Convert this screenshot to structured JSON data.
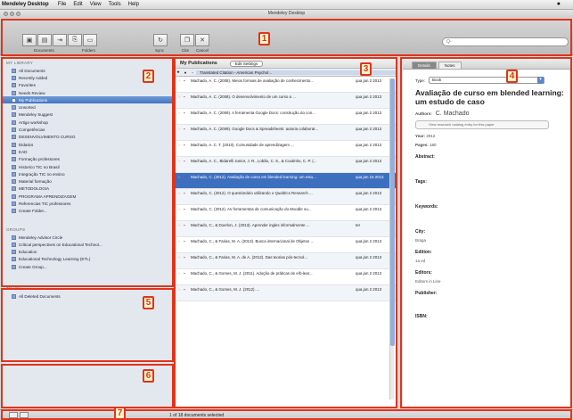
{
  "menubar": {
    "app": "Mendeley Desktop",
    "items": [
      "File",
      "Edit",
      "View",
      "Tools",
      "Help"
    ]
  },
  "window": {
    "title": "Mendeley Desktop"
  },
  "toolbar": {
    "groups": [
      {
        "label": "Documents"
      },
      {
        "label": "Folders"
      },
      {
        "label": "Sync"
      },
      {
        "label": "Cite"
      },
      {
        "label": "Cancel"
      }
    ],
    "search_placeholder": "Q-"
  },
  "callouts": [
    "1",
    "2",
    "3",
    "4",
    "5",
    "6",
    "7"
  ],
  "sidebar": {
    "library_title": "MY LIBRARY",
    "library_items": [
      "All Documents",
      "Recently Added",
      "Favorites",
      "Needs Review",
      "My Publications",
      "Unsorted",
      "Mendeley Suggest",
      "Artigo workshop",
      "Competências",
      "DESENVOLVIMENTO CURSO",
      "Didatics",
      "EAD",
      "Formação professores",
      "Historico TIC no Brasil",
      "Integração TIC no ensino",
      "Material formação",
      "METODOLOGIA",
      "PROGRAMA APRENDIZAGEM",
      "Referencias TIC professores",
      "Create Folder..."
    ],
    "selected_index": 4,
    "groups_title": "GROUPS",
    "groups_items": [
      "Mendeley Advisor Circle",
      "Critical perspectives on Educational Technol...",
      "Education",
      "Educational Technology Learning (ETL)",
      "Create Group..."
    ],
    "trash_title": "TRASH",
    "trash_items": [
      "All Deleted Documents"
    ]
  },
  "middle": {
    "title": "My Publications",
    "edit_settings": "Edit Settings",
    "column_title": "Translated Citation - American Psychol...",
    "rows": [
      {
        "text": "Machado, A. C. (2008). Meios formais de avaliação de conhecimento...",
        "date": "qua jan 2 2013"
      },
      {
        "text": "Machado, A. C. (2008). O desenvolvimento de um curso a ...",
        "date": "qua jan 2 2013"
      },
      {
        "text": "Machado, A. C. (2009). A ferramenta Google Docs: construção do con...",
        "date": "qua jan 2 2013"
      },
      {
        "text": "Machado, A. C. (2009). Google Docs & Spreadsheets: autoria colaborat...",
        "date": "qua jan 2 2013"
      },
      {
        "text": "Machado, A. C. T. (2010). Comunidade de aprendizagem ...",
        "date": "qua jan 2 2013"
      },
      {
        "text": "Machado, A. C., Bidarelli Junior, J. R., Lobão, C. S., & Coutinho, C. P. (...",
        "date": "qua jan 2 2013"
      },
      {
        "text": "Machado, C. (2012). Avaliação de curso em blended learning: um estu...",
        "date": "qua jan 16 2013"
      },
      {
        "text": "Machado, C. (2012). O questionário utilizando o Qualtrics Research ...",
        "date": "qua jan 2 2013"
      },
      {
        "text": "Machado, C. (2012). As ferramentas de comunicação do Moodle ou...",
        "date": "qua jan 2 2013"
      },
      {
        "text": "Machado, C., & Doerlon, J. (2013). Aprender ingles informalmente ...",
        "date": "ter"
      },
      {
        "text": "Machado, C., & Farias, M. A. (2013). Busca internacional de Objetos ...",
        "date": "qua jan 2 2013"
      },
      {
        "text": "Machado, C., & Farias, M. A. de A. (2012). Das teorias pós-tecnol...",
        "date": "qua jan 2 2013"
      },
      {
        "text": "Machado, C., & Gomes, M. J. (2011). Adoção de práticas de e/b-lear...",
        "date": "qua jan 2 2013"
      },
      {
        "text": "Machado, C., & Gomes, M. J. (2012). ...",
        "date": "qua jan 2 2013"
      }
    ],
    "selected_row": 6
  },
  "details": {
    "tabs": [
      "Details",
      "Notes"
    ],
    "type_label": "Type:",
    "type_value": "Book",
    "title": "Avaliação de curso em blended learning: um estudo de caso",
    "authors_label": "Authors:",
    "author": "C. Machado",
    "catalog_note": "View research catalog entry for this paper",
    "year_label": "Year:",
    "year": "2012",
    "pages_label": "Pages:",
    "pages": "180",
    "abstract_label": "Abstract:",
    "tags_label": "Tags:",
    "keywords_label": "Keywords:",
    "city_label": "City:",
    "city": "Braga",
    "edition_label": "Edition:",
    "edition": "1a ed",
    "editors_label": "Editors:",
    "editors": "Editors in Line",
    "publisher_label": "Publisher:",
    "isbn_label": "ISBN:"
  },
  "status": {
    "text": "1 of 18 documents selected"
  }
}
